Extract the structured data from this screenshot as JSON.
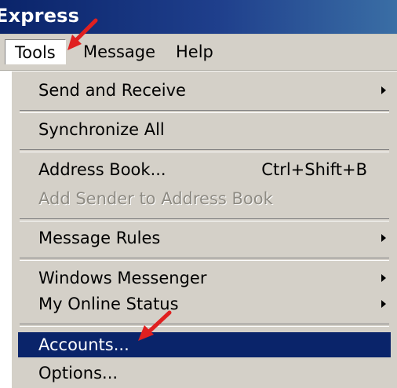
{
  "window": {
    "title": "Express"
  },
  "menubar": {
    "items": [
      {
        "label": "Tools",
        "active": true
      },
      {
        "label": "Message"
      },
      {
        "label": "Help"
      }
    ]
  },
  "menu": {
    "items": [
      {
        "label": "Send and Receive",
        "submenu": true
      },
      {
        "label": "Synchronize All"
      },
      {
        "label": "Address Book...",
        "shortcut": "Ctrl+Shift+B"
      },
      {
        "label": "Add Sender to Address Book",
        "disabled": true
      },
      {
        "label": "Message Rules",
        "submenu": true
      },
      {
        "label": "Windows Messenger",
        "submenu": true
      },
      {
        "label": "My Online Status",
        "submenu": true
      },
      {
        "label": "Accounts...",
        "highlighted": true
      },
      {
        "label": "Options..."
      }
    ]
  },
  "annotations": [
    {
      "icon": "red-arrow-icon",
      "color": "#e02020",
      "points_to": "Tools"
    },
    {
      "icon": "red-arrow-icon",
      "color": "#e02020",
      "points_to": "Accounts..."
    }
  ],
  "colors": {
    "title_bar": "#0a246a",
    "menu_face": "#d4d0c8",
    "highlight": "#0a246a",
    "disabled_text": "#8d8a82"
  }
}
